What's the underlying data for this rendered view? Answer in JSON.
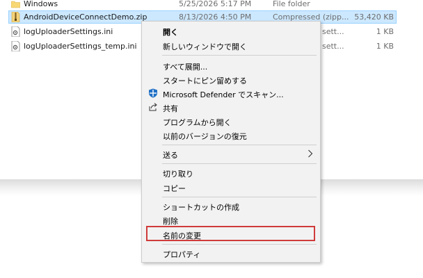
{
  "files": [
    {
      "name": "Windows",
      "date": "5/25/2026 5:17 PM",
      "type": "File folder",
      "size": "",
      "icon": "folder-icon",
      "selected": false
    },
    {
      "name": "AndroidDeviceConnectDemo.zip",
      "date": "8/13/2026 4:50 PM",
      "type": "Compressed (zipp...",
      "size": "53,420 KB",
      "icon": "zip-file-icon",
      "selected": true
    },
    {
      "name": "logUploaderSettings.ini",
      "date": "",
      "type": "sett...",
      "size": "1 KB",
      "icon": "settings-file-icon",
      "selected": false
    },
    {
      "name": "logUploaderSettings_temp.ini",
      "date": "",
      "type": "sett...",
      "size": "1 KB",
      "icon": "settings-file-icon",
      "selected": false
    }
  ],
  "context_menu": {
    "open": "開く",
    "open_new_window": "新しいウィンドウで開く",
    "extract_all": "すべて展開...",
    "pin_to_start": "スタートにピン留めする",
    "defender_scan": "Microsoft Defender でスキャン...",
    "share": "共有",
    "open_with": "プログラムから開く",
    "restore_previous": "以前のバージョンの復元",
    "send_to": "送る",
    "cut": "切り取り",
    "copy": "コピー",
    "create_shortcut": "ショートカットの作成",
    "delete": "削除",
    "rename": "名前の変更",
    "properties": "プロパティ"
  },
  "icons": {
    "defender": "defender-shield-icon",
    "share": "share-icon",
    "submenu": "chevron-right-icon"
  },
  "colors": {
    "selection": "#cce8ff",
    "highlight_box": "#d03a3a",
    "menu_background": "#f2f2f2"
  }
}
